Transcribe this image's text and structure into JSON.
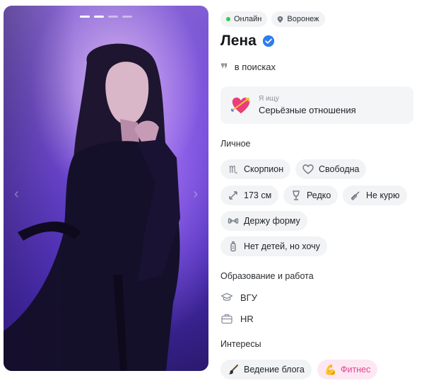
{
  "photo": {
    "dots_total": 4,
    "dots_active": 2
  },
  "top_chips": {
    "online": "Онлайн",
    "city": "Воронеж"
  },
  "profile": {
    "name": "Лена",
    "status": "в поисках"
  },
  "seeking": {
    "label": "Я ищу",
    "value": "Серьёзные отношения"
  },
  "personal": {
    "title": "Личное",
    "tags": [
      {
        "label": "Скорпион",
        "icon": "scorpio-icon"
      },
      {
        "label": "Свободна",
        "icon": "heart-outline-icon"
      },
      {
        "label": "173 см",
        "icon": "height-arrows-icon"
      },
      {
        "label": "Редко",
        "icon": "wine-glass-icon"
      },
      {
        "label": "Не курю",
        "icon": "no-smoking-icon"
      },
      {
        "label": "Держу форму",
        "icon": "dumbbell-icon"
      },
      {
        "label": "Нет детей, но хочу",
        "icon": "baby-bottle-icon"
      }
    ]
  },
  "education": {
    "title": "Образование и работа",
    "university": "ВГУ",
    "job": "HR"
  },
  "interests": {
    "title": "Интересы",
    "tags": [
      {
        "label": "Ведение блога",
        "icon": "brush-icon"
      },
      {
        "label": "Фитнес",
        "icon": "flexed-biceps-icon"
      }
    ]
  },
  "colors": {
    "online": "#2ecc55",
    "verified": "#2e7cf6",
    "fitness_tag_bg": "#fde7f3",
    "fitness_tag_text": "#e0458c"
  }
}
